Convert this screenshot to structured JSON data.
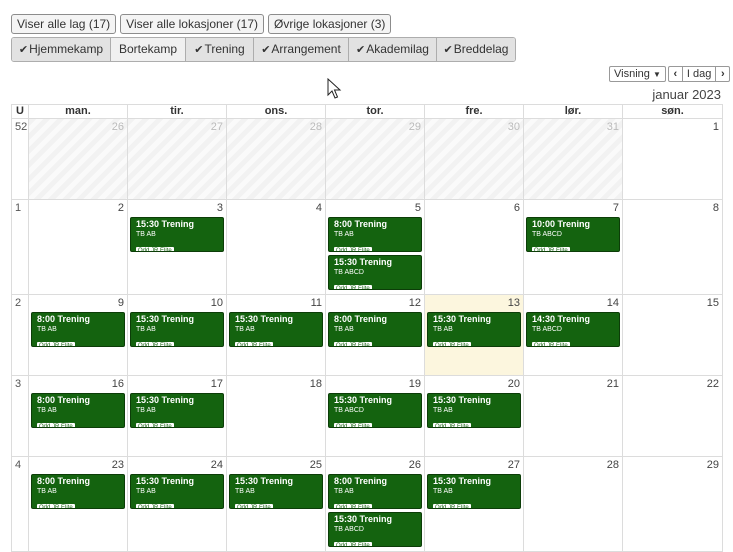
{
  "toolbar": {
    "buttons": [
      {
        "label": "Viser alle lag (17)",
        "width": 94
      },
      {
        "label": "Viser alle lokasjoner (17)",
        "width": 128
      },
      {
        "label": "Øvrige lokasjoner (3)",
        "width": 113
      }
    ]
  },
  "filters": [
    {
      "label": "Hjemmekamp",
      "checked": true
    },
    {
      "label": "Bortekamp",
      "checked": false
    },
    {
      "label": "Trening",
      "checked": true
    },
    {
      "label": "Arrangement",
      "checked": true
    },
    {
      "label": "Akademilag",
      "checked": true
    },
    {
      "label": "Breddelag",
      "checked": true
    }
  ],
  "view_controls": {
    "view_label": "Visning",
    "prev": "‹",
    "today": "I dag",
    "next": "›"
  },
  "calendar": {
    "month_title": "januar 2023",
    "week_header": "U",
    "weekdays": [
      "man.",
      "tir.",
      "ons.",
      "tor.",
      "fre.",
      "lør.",
      "søn."
    ],
    "weeks": [
      {
        "week": "52",
        "days": [
          {
            "day": "26",
            "other": true,
            "events": []
          },
          {
            "day": "27",
            "other": true,
            "events": []
          },
          {
            "day": "28",
            "other": true,
            "events": []
          },
          {
            "day": "29",
            "other": true,
            "events": []
          },
          {
            "day": "30",
            "other": true,
            "events": []
          },
          {
            "day": "31",
            "other": true,
            "events": []
          },
          {
            "day": "1",
            "events": []
          }
        ]
      },
      {
        "week": "1",
        "days": [
          {
            "day": "2",
            "events": []
          },
          {
            "day": "3",
            "events": [
              {
                "time": "15:30",
                "title": "Trening",
                "team": "TB AB",
                "tag": "Odd JR Elite"
              }
            ]
          },
          {
            "day": "4",
            "events": []
          },
          {
            "day": "5",
            "events": [
              {
                "time": "8:00",
                "title": "Trening",
                "team": "TB AB",
                "tag": "Odd JR Elite"
              },
              {
                "time": "15:30",
                "title": "Trening",
                "team": "TB ABCD",
                "tag": "Odd JR Elite"
              }
            ]
          },
          {
            "day": "6",
            "events": []
          },
          {
            "day": "7",
            "events": [
              {
                "time": "10:00",
                "title": "Trening",
                "team": "TB ABCD",
                "tag": "Odd JR Elite"
              }
            ]
          },
          {
            "day": "8",
            "events": []
          }
        ]
      },
      {
        "week": "2",
        "days": [
          {
            "day": "9",
            "events": [
              {
                "time": "8:00",
                "title": "Trening",
                "team": "TB AB",
                "tag": "Odd JR Elite"
              }
            ]
          },
          {
            "day": "10",
            "events": [
              {
                "time": "15:30",
                "title": "Trening",
                "team": "TB AB",
                "tag": "Odd JR Elite"
              }
            ]
          },
          {
            "day": "11",
            "events": [
              {
                "time": "15:30",
                "title": "Trening",
                "team": "TB AB",
                "tag": "Odd JR Elite"
              }
            ]
          },
          {
            "day": "12",
            "events": [
              {
                "time": "8:00",
                "title": "Trening",
                "team": "TB AB",
                "tag": "Odd JR Elite"
              }
            ]
          },
          {
            "day": "13",
            "today": true,
            "events": [
              {
                "time": "15:30",
                "title": "Trening",
                "team": "TB AB",
                "tag": "Odd JR Elite"
              }
            ]
          },
          {
            "day": "14",
            "events": [
              {
                "time": "14:30",
                "title": "Trening",
                "team": "TB ABCD",
                "tag": "Odd JR Elite"
              }
            ]
          },
          {
            "day": "15",
            "events": []
          }
        ]
      },
      {
        "week": "3",
        "days": [
          {
            "day": "16",
            "events": [
              {
                "time": "8:00",
                "title": "Trening",
                "team": "TB AB",
                "tag": "Odd JR Elite"
              }
            ]
          },
          {
            "day": "17",
            "events": [
              {
                "time": "15:30",
                "title": "Trening",
                "team": "TB AB",
                "tag": "Odd JR Elite"
              }
            ]
          },
          {
            "day": "18",
            "events": []
          },
          {
            "day": "19",
            "events": [
              {
                "time": "15:30",
                "title": "Trening",
                "team": "TB ABCD",
                "tag": "Odd JR Elite"
              }
            ]
          },
          {
            "day": "20",
            "events": [
              {
                "time": "15:30",
                "title": "Trening",
                "team": "TB AB",
                "tag": "Odd JR Elite"
              }
            ]
          },
          {
            "day": "21",
            "events": []
          },
          {
            "day": "22",
            "events": []
          }
        ]
      },
      {
        "week": "4",
        "days": [
          {
            "day": "23",
            "events": [
              {
                "time": "8:00",
                "title": "Trening",
                "team": "TB AB",
                "tag": "Odd JR Elite"
              }
            ]
          },
          {
            "day": "24",
            "events": [
              {
                "time": "15:30",
                "title": "Trening",
                "team": "TB AB",
                "tag": "Odd JR Elite"
              }
            ]
          },
          {
            "day": "25",
            "events": [
              {
                "time": "15:30",
                "title": "Trening",
                "team": "TB AB",
                "tag": "Odd JR Elite"
              }
            ]
          },
          {
            "day": "26",
            "events": [
              {
                "time": "8:00",
                "title": "Trening",
                "team": "TB AB",
                "tag": "Odd JR Elite"
              },
              {
                "time": "15:30",
                "title": "Trening",
                "team": "TB ABCD",
                "tag": "Odd JR Elite"
              }
            ]
          },
          {
            "day": "27",
            "events": [
              {
                "time": "15:30",
                "title": "Trening",
                "team": "TB AB",
                "tag": "Odd JR Elite"
              }
            ]
          },
          {
            "day": "28",
            "events": []
          },
          {
            "day": "29",
            "events": []
          }
        ]
      }
    ]
  }
}
